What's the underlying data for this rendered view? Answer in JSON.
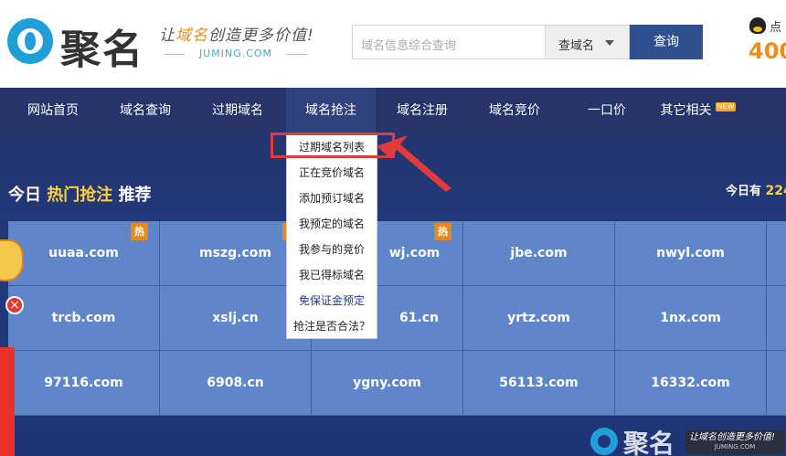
{
  "header": {
    "logo_text": "聚名",
    "slogan_pre": "让",
    "slogan_hl": "域名",
    "slogan_post": "创造更多价值!",
    "slogan_domain": "JUMING.COM",
    "search_placeholder": "域名信息综合查询",
    "search_type": "查域名",
    "search_button": "查询",
    "qq_label": "点",
    "phone": "400"
  },
  "nav": {
    "items": [
      {
        "label": "网站首页"
      },
      {
        "label": "域名查询"
      },
      {
        "label": "过期域名"
      },
      {
        "label": "域名抢注"
      },
      {
        "label": "域名注册"
      },
      {
        "label": "域名竞价"
      },
      {
        "label": "一口价"
      },
      {
        "label": "其它相关",
        "badge": "NEW"
      }
    ]
  },
  "dropdown": {
    "items": [
      "过期域名列表",
      "正在竞价域名",
      "添加预订域名",
      "我预定的域名",
      "我参与的竞价",
      "我已得标域名",
      "免保证金预定",
      "抢注是否合法？"
    ]
  },
  "section": {
    "title_pre": "今日",
    "title_hl": "热门抢注",
    "title_post": "推荐",
    "today_label": "今日有",
    "today_count": "224"
  },
  "domains": {
    "rows": [
      [
        {
          "name": "uuaa.com",
          "hot": true
        },
        {
          "name": "mszg.com",
          "hot": true
        },
        {
          "name": "wj.com",
          "hot": true
        },
        {
          "name": "jbe.com",
          "hot": false
        },
        {
          "name": "nwyl.com",
          "hot": false
        }
      ],
      [
        {
          "name": "trcb.com",
          "hot": false
        },
        {
          "name": "xslj.cn",
          "hot": false
        },
        {
          "name": "61.cn",
          "hot": false
        },
        {
          "name": "yrtz.com",
          "hot": false
        },
        {
          "name": "1nx.com",
          "hot": false
        }
      ],
      [
        {
          "name": "97116.com",
          "hot": false
        },
        {
          "name": "6908.cn",
          "hot": false
        },
        {
          "name": "ygny.com",
          "hot": false
        },
        {
          "name": "56113.com",
          "hot": false
        },
        {
          "name": "16332.com",
          "hot": false
        }
      ]
    ],
    "hot_label": "热"
  },
  "footer_logo": {
    "text": "聚名",
    "slogan": "让域名创造更多价值!",
    "domain": "JUMING.COM"
  },
  "float": {
    "close": "×"
  },
  "colors": {
    "nav_bg": "#25346a",
    "accent_orange": "#f08c1a",
    "cell_bg": "#5e86c9",
    "highlight_red": "#e33b3b"
  }
}
